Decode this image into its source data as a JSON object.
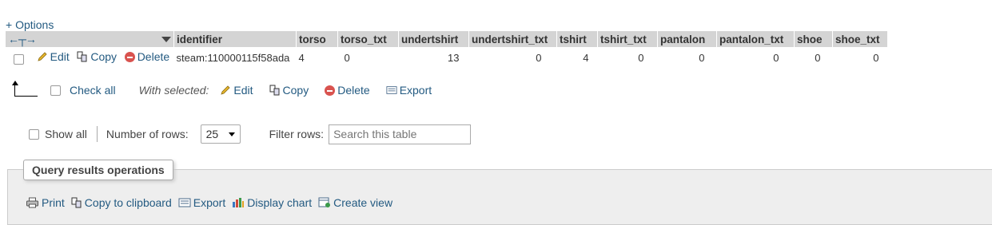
{
  "options_link": "+ Options",
  "columns": [
    "identifier",
    "torso",
    "torso_txt",
    "undertshirt",
    "undertshirt_txt",
    "tshirt",
    "tshirt_txt",
    "pantalon",
    "pantalon_txt",
    "shoe",
    "shoe_txt"
  ],
  "row": {
    "edit": "Edit",
    "copy": "Copy",
    "delete": "Delete",
    "identifier": "steam:110000115f58ada",
    "torso": "4",
    "torso_txt": "0",
    "undertshirt": "13",
    "undertshirt_txt": "0",
    "tshirt": "4",
    "tshirt_txt": "0",
    "pantalon": "0",
    "pantalon_txt": "0",
    "shoe": "0",
    "shoe_txt": "0"
  },
  "bulk": {
    "check_all": "Check all",
    "with_selected": "With selected:",
    "edit": "Edit",
    "copy": "Copy",
    "delete": "Delete",
    "export": "Export"
  },
  "nav": {
    "show_all": "Show all",
    "rows_label": "Number of rows:",
    "rows_value": "25",
    "filter_label": "Filter rows:",
    "filter_placeholder": "Search this table"
  },
  "ops": {
    "legend": "Query results operations",
    "print": "Print",
    "copy_clipboard": "Copy to clipboard",
    "export": "Export",
    "display_chart": "Display chart",
    "create_view": "Create view"
  }
}
